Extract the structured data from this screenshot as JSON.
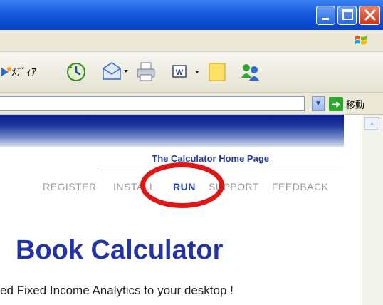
{
  "window": {
    "title_buttons": {
      "minimize_icon": "minimize-icon",
      "maximize_icon": "maximize-icon",
      "close_icon": "close-icon"
    }
  },
  "toolbar": {
    "media_label": "ﾒﾃﾞｨｱ"
  },
  "address_bar": {
    "value": "",
    "go_label": "移動"
  },
  "page": {
    "subtitle": "The Calculator Home Page",
    "nav": [
      {
        "label": "REGISTER",
        "active": false
      },
      {
        "label": "INSTALL",
        "active": false
      },
      {
        "label": "RUN",
        "active": true
      },
      {
        "label": "SUPPORT",
        "active": false
      },
      {
        "label": "FEEDBACK",
        "active": false
      }
    ],
    "heading": "Book Calculator",
    "tagline": "ed Fixed Income Analytics to your desktop !"
  },
  "colors": {
    "titlebar": "#1b5fe0",
    "highlight_ellipse": "#e01515",
    "nav_active": "#1c3fb5",
    "nav_inactive": "#9a9a9a",
    "heading": "#2233aa"
  }
}
